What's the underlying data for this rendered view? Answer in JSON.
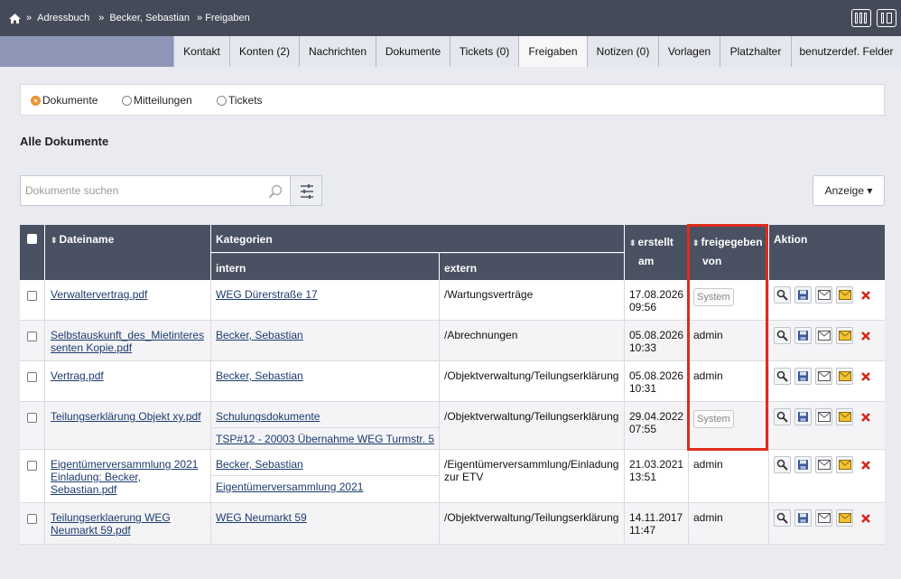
{
  "breadcrumb": [
    "»",
    "Adressbuch",
    "»",
    "Becker, Sebastian",
    "» Freigaben"
  ],
  "tabs": [
    "Kontakt",
    "Konten (2)",
    "Nachrichten",
    "Dokumente",
    "Tickets (0)",
    "Freigaben",
    "Notizen (0)",
    "Vorlagen",
    "Platzhalter",
    "benutzerdef. Felder"
  ],
  "active_tab": "Freigaben",
  "filter": {
    "options": [
      "Dokumente",
      "Mitteilungen",
      "Tickets"
    ],
    "selected": "Dokumente"
  },
  "section_title": "Alle Dokumente",
  "search": {
    "placeholder": "Dokumente suchen"
  },
  "anzeige_label": "Anzeige ▾",
  "table": {
    "headers": {
      "dateiname": "Dateiname",
      "kategorien": "Kategorien",
      "intern": "intern",
      "extern": "extern",
      "erstellt_1": "erstellt",
      "erstellt_2": "am",
      "freigegeben_1": "freigegeben",
      "freigegeben_2": "von",
      "aktion": "Aktion"
    },
    "rows": [
      {
        "file": [
          "Verwaltervertrag.pdf"
        ],
        "intern": [
          "WEG Dürerstraße 17"
        ],
        "extern": "/Wartungsverträge",
        "date": "17.08.2026",
        "time": "09:56",
        "by": "System"
      },
      {
        "file": [
          "Selbstauskunft_des_Mietinteres",
          "senten Kopie.pdf"
        ],
        "intern": [
          "Becker, Sebastian"
        ],
        "extern": "/Abrechnungen",
        "date": "05.08.2026",
        "time": "10:33",
        "by": "admin"
      },
      {
        "file": [
          "Vertrag.pdf"
        ],
        "intern": [
          "Becker, Sebastian"
        ],
        "extern": "/Objektverwaltung/Teilungserklärung",
        "date": "05.08.2026",
        "time": "10:31",
        "by": "admin"
      },
      {
        "file": [
          "Teilungserklärung Objekt xy.pdf"
        ],
        "intern": [
          "Schulungsdokumente",
          "TSP#12 - 20003 Übernahme WEG Turmstr. 5"
        ],
        "extern": "/Objektverwaltung/Teilungserklärung",
        "date": "29.04.2022",
        "time": "07:55",
        "by": "System"
      },
      {
        "file": [
          "Eigentümerversammlung 2021",
          "Einladung: Becker,",
          "Sebastian.pdf"
        ],
        "intern": [
          "Becker, Sebastian",
          "Eigentümerversammlung 2021"
        ],
        "extern": "/Eigentümerversammlung/Einladung zur ETV",
        "date": "21.03.2021",
        "time": "13:51",
        "by": "admin"
      },
      {
        "file": [
          "Teilungserklaerung WEG",
          "Neumarkt 59.pdf"
        ],
        "intern": [
          "WEG Neumarkt 59"
        ],
        "extern": "/Objektverwaltung/Teilungserklärung",
        "date": "14.11.2017",
        "time": "11:47",
        "by": "admin"
      }
    ]
  },
  "icons": {
    "home": "home-icon",
    "view_columns": "columns-view-icon",
    "view_list": "list-view-icon",
    "search": "search-icon",
    "filter": "filter-sliders-icon",
    "view": "magnifier-icon",
    "save": "floppy-disk-icon",
    "mail": "envelope-icon",
    "mail_yellow": "envelope-yellow-icon",
    "delete": "red-x-icon"
  },
  "colors": {
    "topbar": "#444a58",
    "tabsbar": "#8d96b6",
    "header": "#4a5162",
    "link": "#1d3b6e",
    "highlight": "#e02b1c",
    "radio_on": "#f09a3a"
  }
}
